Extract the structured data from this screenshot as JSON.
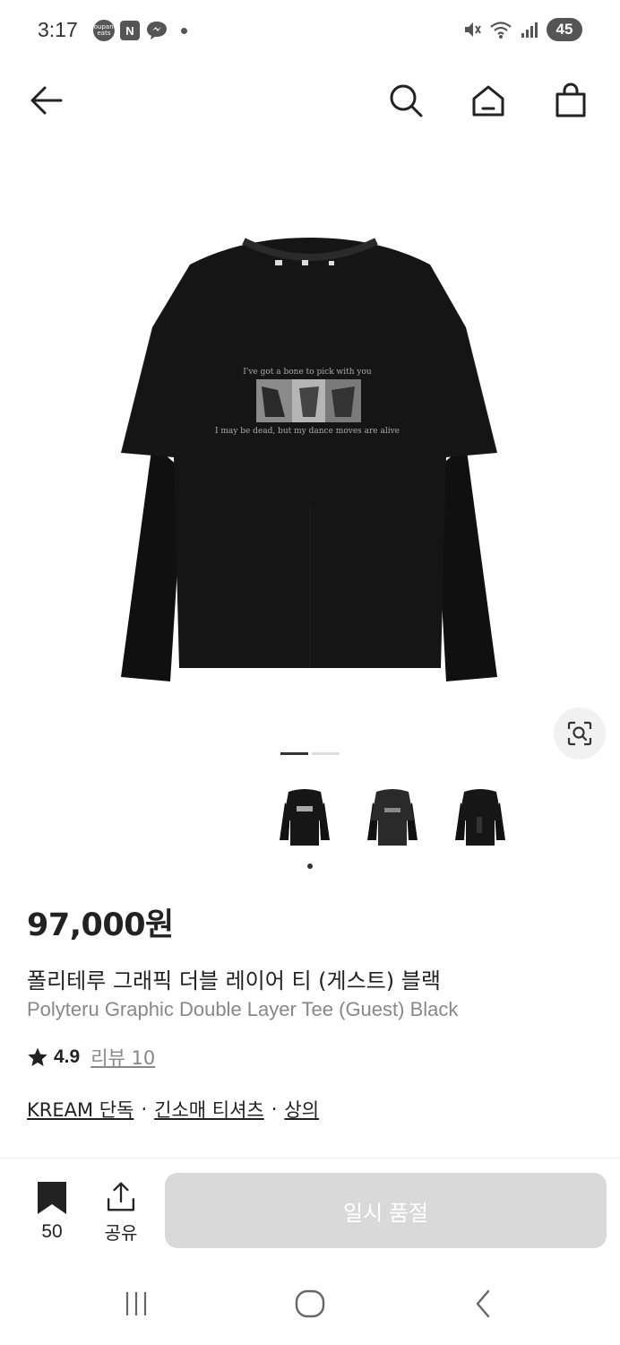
{
  "status_bar": {
    "time": "3:17",
    "app_badge_label": "coupang eats",
    "n_badge_label": "N",
    "battery": "45"
  },
  "icons": {
    "back": "arrow-left-icon",
    "search": "search-icon",
    "home": "home-icon",
    "cart": "shopping-bag-icon",
    "lens": "lens-search-icon",
    "bookmark": "bookmark-icon",
    "share": "share-icon"
  },
  "product": {
    "price": "97,000원",
    "title_ko": "폴리테루 그래픽 더블 레이어 티 (게스트) 블랙",
    "title_en": "Polyteru Graphic Double Layer Tee (Guest) Black",
    "rating": "4.9",
    "review_link": "리뷰 10",
    "categories": [
      "KREAM 단독",
      "긴소매 티셔츠",
      "상의"
    ],
    "separator": "·",
    "image_count": 2,
    "active_image_index": 0,
    "thumbnail_count": 3,
    "print_text_top": "I've got a bone to pick with you",
    "print_text_bottom": "I may be dead, but my dance moves are alive"
  },
  "actions": {
    "bookmark_count": "50",
    "share_label": "공유",
    "soldout_label": "일시 품절"
  },
  "colors": {
    "tee": "#151515",
    "soldout_bg": "#d9d9d9",
    "secondary_text": "#888888"
  }
}
